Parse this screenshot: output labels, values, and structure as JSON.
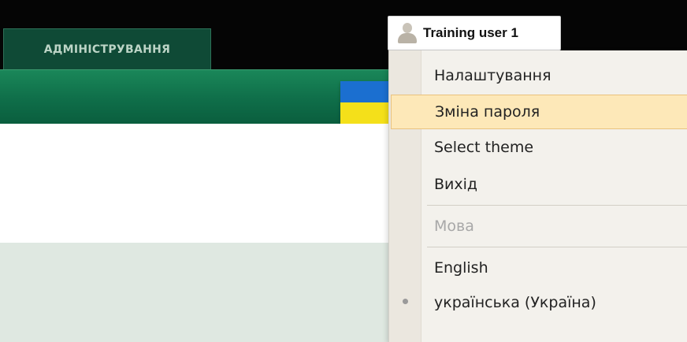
{
  "header": {
    "admin_tab_label": "АДМІНІСТРУВАННЯ"
  },
  "user_menu": {
    "user_name": "Training user 1",
    "items": [
      {
        "label": "Налаштування"
      },
      {
        "label": "Зміна пароля",
        "state": "hovered"
      },
      {
        "label": "Select theme"
      },
      {
        "label": "Вихід"
      }
    ],
    "language_section_label": "Мова",
    "languages": [
      {
        "label": "English",
        "selected": false
      },
      {
        "label": "українська (Україна)",
        "selected": true
      }
    ]
  },
  "colors": {
    "top_bar": "#050505",
    "admin_tab": "#0f4a36",
    "green_bar": "#0f6e49",
    "menu_highlight": "#fde8b8",
    "flag_blue": "#1b6fd0",
    "flag_yellow": "#f4e01a",
    "content_light": "#dfe8e1"
  },
  "icons": {
    "user": "user-icon",
    "selected_language": "bullet-icon"
  }
}
